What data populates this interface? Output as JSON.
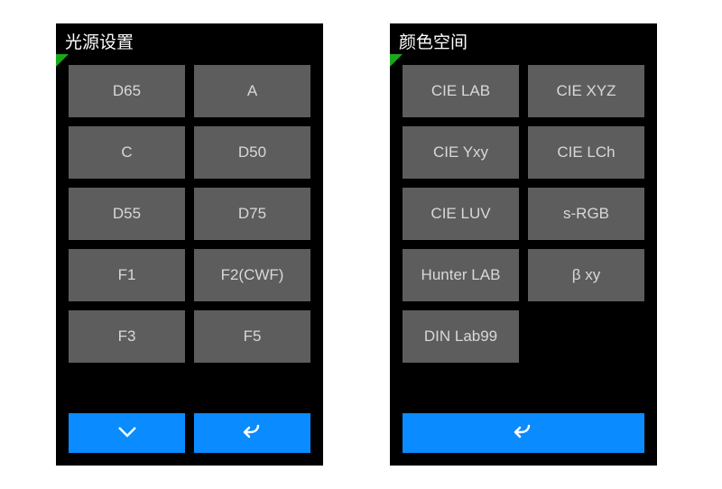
{
  "panels": {
    "light": {
      "title": "光源设置",
      "options": [
        "D65",
        "A",
        "C",
        "D50",
        "D55",
        "D75",
        "F1",
        "F2(CWF)",
        "F3",
        "F5"
      ]
    },
    "colorspace": {
      "title": "颜色空间",
      "options": [
        "CIE LAB",
        "CIE XYZ",
        "CIE Yxy",
        "CIE LCh",
        "CIE LUV",
        "s-RGB",
        "Hunter LAB",
        "β xy",
        "DIN Lab99"
      ]
    }
  },
  "colors": {
    "accent": "#0a8bff",
    "option_bg": "#5d5d5d",
    "selected_mark": "#1aa81a"
  }
}
